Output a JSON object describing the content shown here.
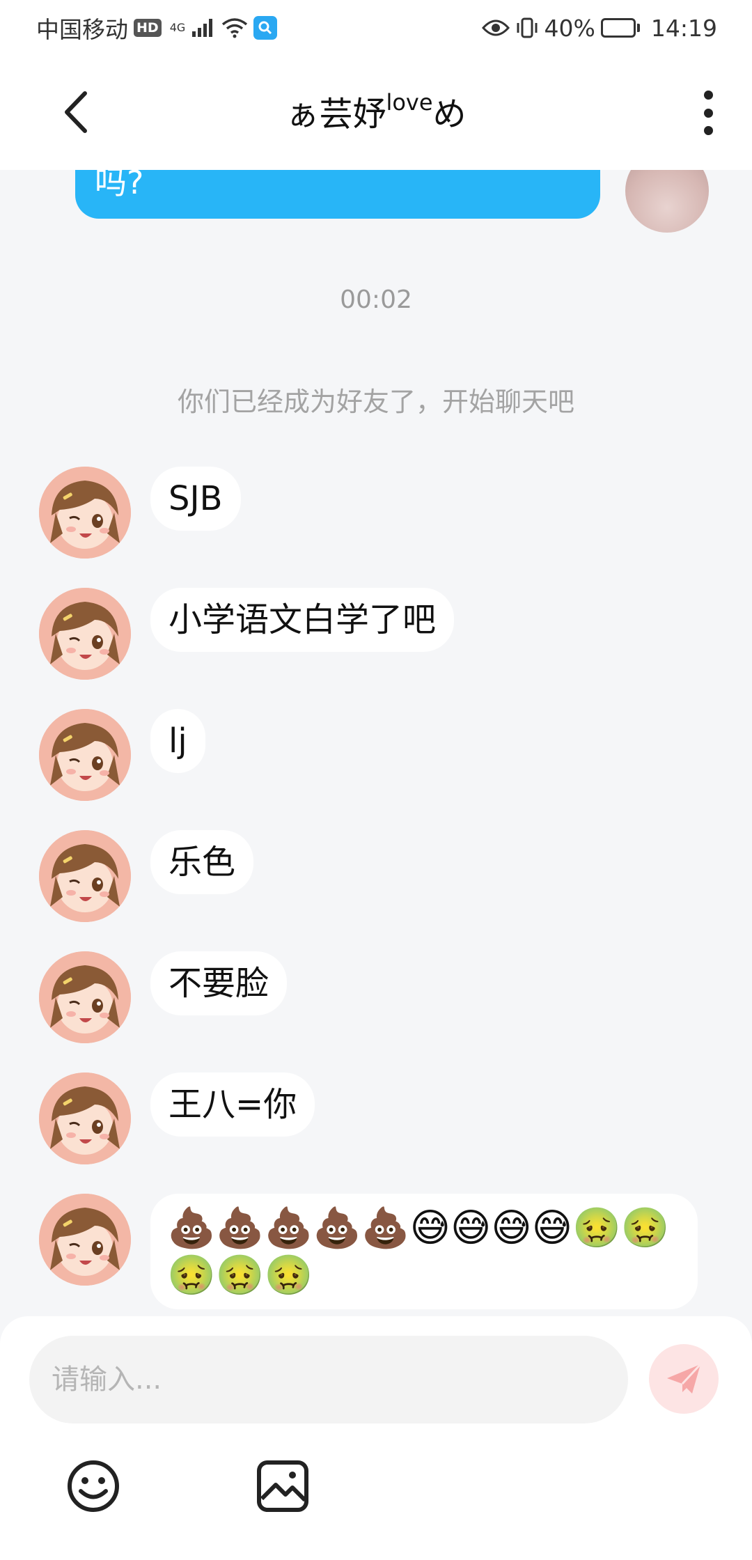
{
  "status_bar": {
    "carrier": "中国移动",
    "hd_badge": "HD",
    "network": "4G",
    "battery_percent": "40%",
    "battery_level": 0.4,
    "time": "14:19"
  },
  "header": {
    "title_prefix": "ぁ芸妤",
    "title_sup": "love",
    "title_suffix": "め"
  },
  "chat": {
    "my_partial_message": "吗?",
    "timestamp": "00:02",
    "system_note": "你们已经成为好友了，开始聊天吧",
    "messages": [
      {
        "text": "SJB"
      },
      {
        "text": "小学语文白学了吧"
      },
      {
        "text": "lj"
      },
      {
        "text": "乐色"
      },
      {
        "text": "不要脸"
      },
      {
        "text": "王八=你"
      },
      {
        "text": "💩💩💩💩💩😅😅😅😅🤢🤢🤢🤢🤢"
      }
    ]
  },
  "composer": {
    "placeholder": "请输入..."
  },
  "colors": {
    "my_bubble": "#28b5f7",
    "send_button_bg": "#fde4e4",
    "send_icon": "#f6a7a7"
  },
  "icons": {
    "back": "chevron-left-icon",
    "more": "more-vertical-icon",
    "send": "paper-plane-icon",
    "emoji": "smiley-icon",
    "image": "image-icon"
  }
}
